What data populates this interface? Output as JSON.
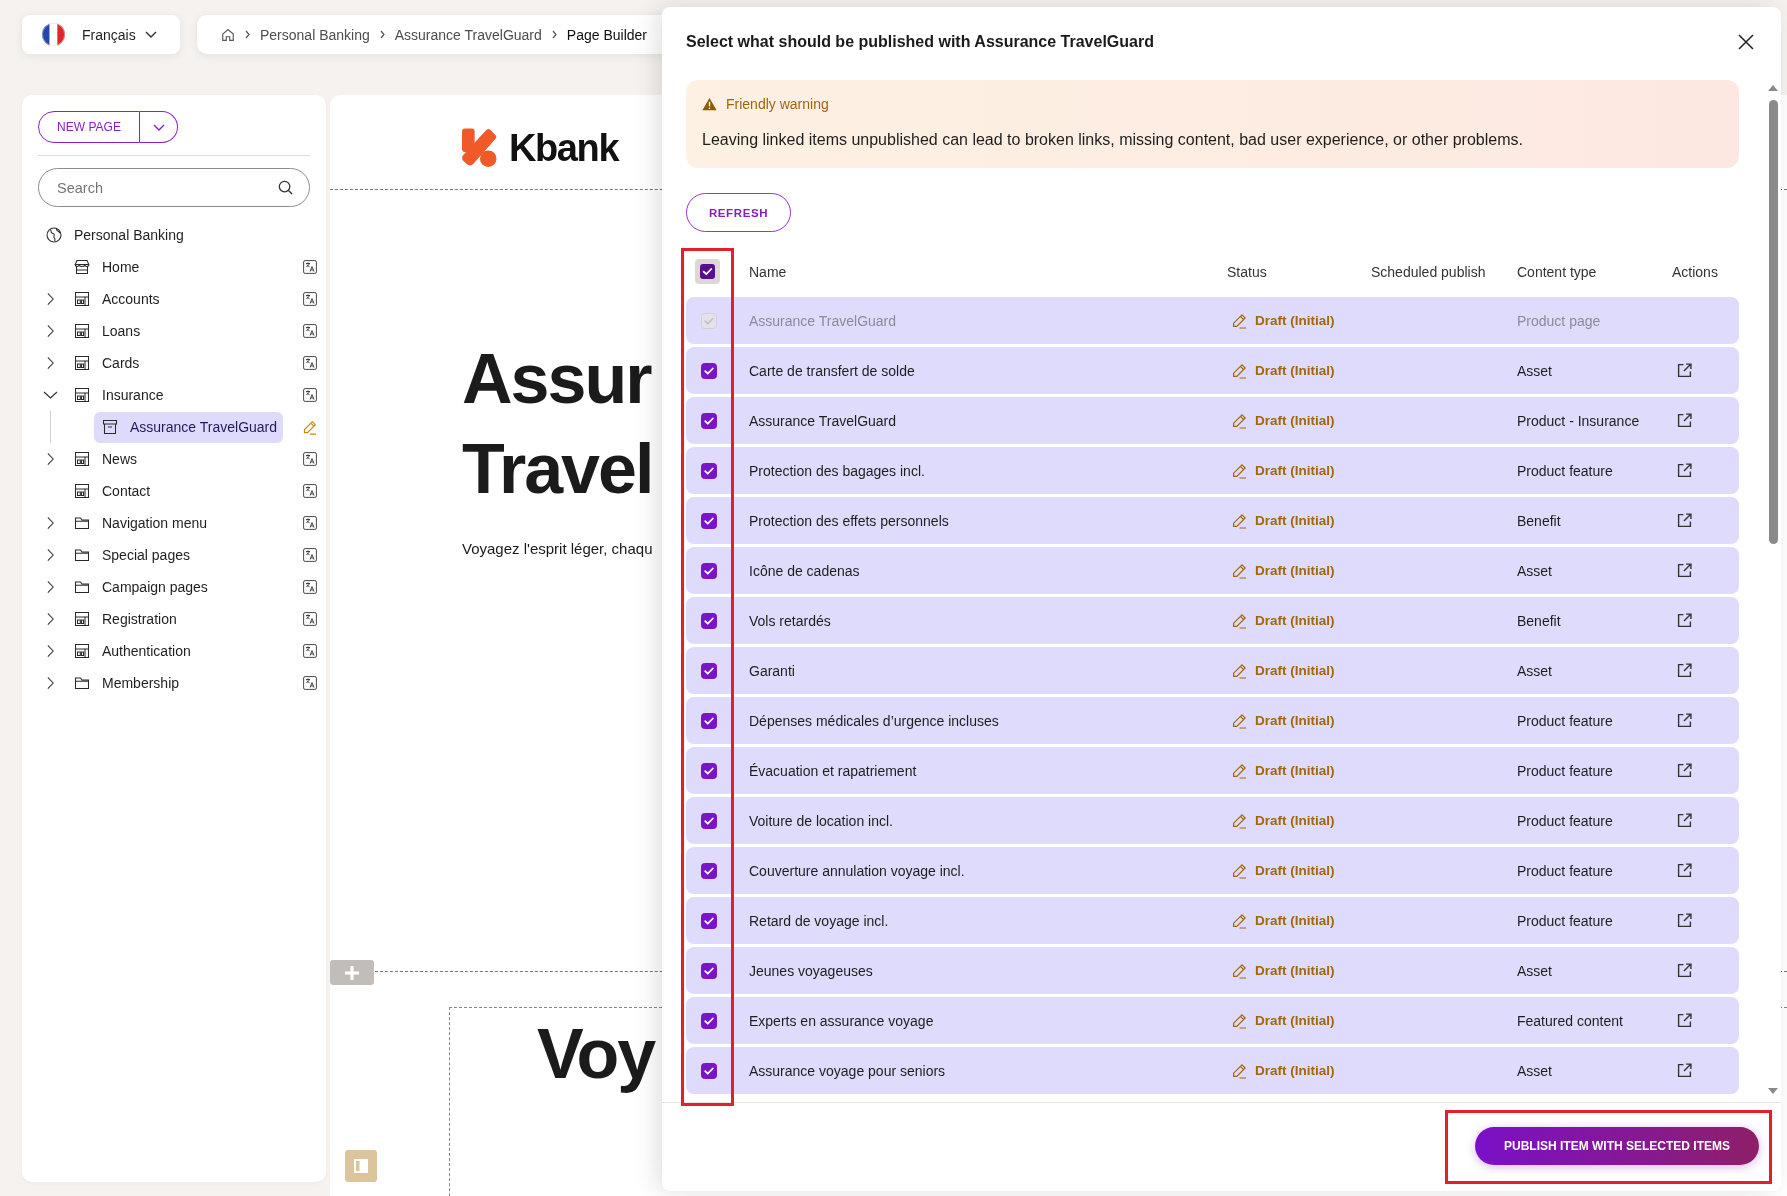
{
  "language_switcher": {
    "label": "Français"
  },
  "breadcrumb": [
    {
      "label": "Personal Banking",
      "current": false
    },
    {
      "label": "Assurance TravelGuard",
      "current": false
    },
    {
      "label": "Page Builder",
      "current": true
    }
  ],
  "sidebar": {
    "new_page_button": "NEW PAGE",
    "search": {
      "placeholder": "Search"
    },
    "tree": [
      {
        "label": "Personal Banking",
        "kind": "site",
        "selected": false,
        "children": [
          {
            "label": "Home",
            "kind": "home",
            "expandable": false,
            "expanded": false,
            "selected": false,
            "draft": false
          },
          {
            "label": "Accounts",
            "kind": "page",
            "expandable": true,
            "expanded": false,
            "selected": false,
            "draft": false
          },
          {
            "label": "Loans",
            "kind": "page",
            "expandable": true,
            "expanded": false,
            "selected": false,
            "draft": false
          },
          {
            "label": "Cards",
            "kind": "page",
            "expandable": true,
            "expanded": false,
            "selected": false,
            "draft": false
          },
          {
            "label": "Insurance",
            "kind": "page",
            "expandable": true,
            "expanded": true,
            "selected": false,
            "draft": false,
            "children": [
              {
                "label": "Assurance TravelGuard",
                "kind": "product",
                "expandable": false,
                "expanded": false,
                "selected": true,
                "draft": true
              }
            ]
          },
          {
            "label": "News",
            "kind": "page",
            "expandable": true,
            "expanded": false,
            "selected": false,
            "draft": false
          },
          {
            "label": "Contact",
            "kind": "page",
            "expandable": false,
            "expanded": false,
            "selected": false,
            "draft": false
          },
          {
            "label": "Navigation menu",
            "kind": "folder",
            "expandable": true,
            "expanded": false,
            "selected": false,
            "draft": false
          },
          {
            "label": "Special pages",
            "kind": "folder",
            "expandable": true,
            "expanded": false,
            "selected": false,
            "draft": false
          },
          {
            "label": "Campaign pages",
            "kind": "folder",
            "expandable": true,
            "expanded": false,
            "selected": false,
            "draft": false
          },
          {
            "label": "Registration",
            "kind": "page",
            "expandable": true,
            "expanded": false,
            "selected": false,
            "draft": false
          },
          {
            "label": "Authentication",
            "kind": "page",
            "expandable": true,
            "expanded": false,
            "selected": false,
            "draft": false
          },
          {
            "label": "Membership",
            "kind": "folder",
            "expandable": true,
            "expanded": false,
            "selected": false,
            "draft": false
          }
        ]
      }
    ]
  },
  "canvas": {
    "logo_text": "Kbank",
    "hero_title_lines": [
      "Assur",
      "Travel"
    ],
    "hero_subtitle": "Voyagez l'esprit léger, chaqu",
    "section_heading": "Voy"
  },
  "modal": {
    "title": "Select what should be published with Assurance TravelGuard",
    "warning": {
      "title": "Friendly warning",
      "message": "Leaving linked items unpublished can lead to broken links, missing content, bad user experience, or other problems."
    },
    "refresh_button": "REFRESH",
    "table": {
      "select_all_checked": true,
      "columns": [
        "Name",
        "Status",
        "Scheduled publish",
        "Content type",
        "Actions"
      ],
      "rows": [
        {
          "checked": true,
          "disabled": true,
          "name": "Assurance TravelGuard",
          "status": "Draft (Initial)",
          "content_type": "Product page"
        },
        {
          "checked": true,
          "disabled": false,
          "name": "Carte de transfert de solde",
          "status": "Draft (Initial)",
          "content_type": "Asset"
        },
        {
          "checked": true,
          "disabled": false,
          "name": "Assurance TravelGuard",
          "status": "Draft (Initial)",
          "content_type": "Product - Insurance"
        },
        {
          "checked": true,
          "disabled": false,
          "name": "Protection des bagages incl.",
          "status": "Draft (Initial)",
          "content_type": "Product feature"
        },
        {
          "checked": true,
          "disabled": false,
          "name": "Protection des effets personnels",
          "status": "Draft (Initial)",
          "content_type": "Benefit"
        },
        {
          "checked": true,
          "disabled": false,
          "name": "Icône de cadenas",
          "status": "Draft (Initial)",
          "content_type": "Asset"
        },
        {
          "checked": true,
          "disabled": false,
          "name": "Vols retardés",
          "status": "Draft (Initial)",
          "content_type": "Benefit"
        },
        {
          "checked": true,
          "disabled": false,
          "name": "Garanti",
          "status": "Draft (Initial)",
          "content_type": "Asset"
        },
        {
          "checked": true,
          "disabled": false,
          "name": "Dépenses médicales d’urgence incluses",
          "status": "Draft (Initial)",
          "content_type": "Product feature"
        },
        {
          "checked": true,
          "disabled": false,
          "name": "Évacuation et rapatriement",
          "status": "Draft (Initial)",
          "content_type": "Product feature"
        },
        {
          "checked": true,
          "disabled": false,
          "name": "Voiture de location incl.",
          "status": "Draft (Initial)",
          "content_type": "Product feature"
        },
        {
          "checked": true,
          "disabled": false,
          "name": "Couverture annulation voyage incl.",
          "status": "Draft (Initial)",
          "content_type": "Product feature"
        },
        {
          "checked": true,
          "disabled": false,
          "name": "Retard de voyage incl.",
          "status": "Draft (Initial)",
          "content_type": "Product feature"
        },
        {
          "checked": true,
          "disabled": false,
          "name": "Jeunes voyageuses",
          "status": "Draft (Initial)",
          "content_type": "Asset"
        },
        {
          "checked": true,
          "disabled": false,
          "name": "Experts en assurance voyage",
          "status": "Draft (Initial)",
          "content_type": "Featured content"
        },
        {
          "checked": true,
          "disabled": false,
          "name": "Assurance voyage pour seniors",
          "status": "Draft (Initial)",
          "content_type": "Asset"
        }
      ]
    },
    "publish_button": "PUBLISH ITEM WITH SELECTED ITEMS"
  }
}
